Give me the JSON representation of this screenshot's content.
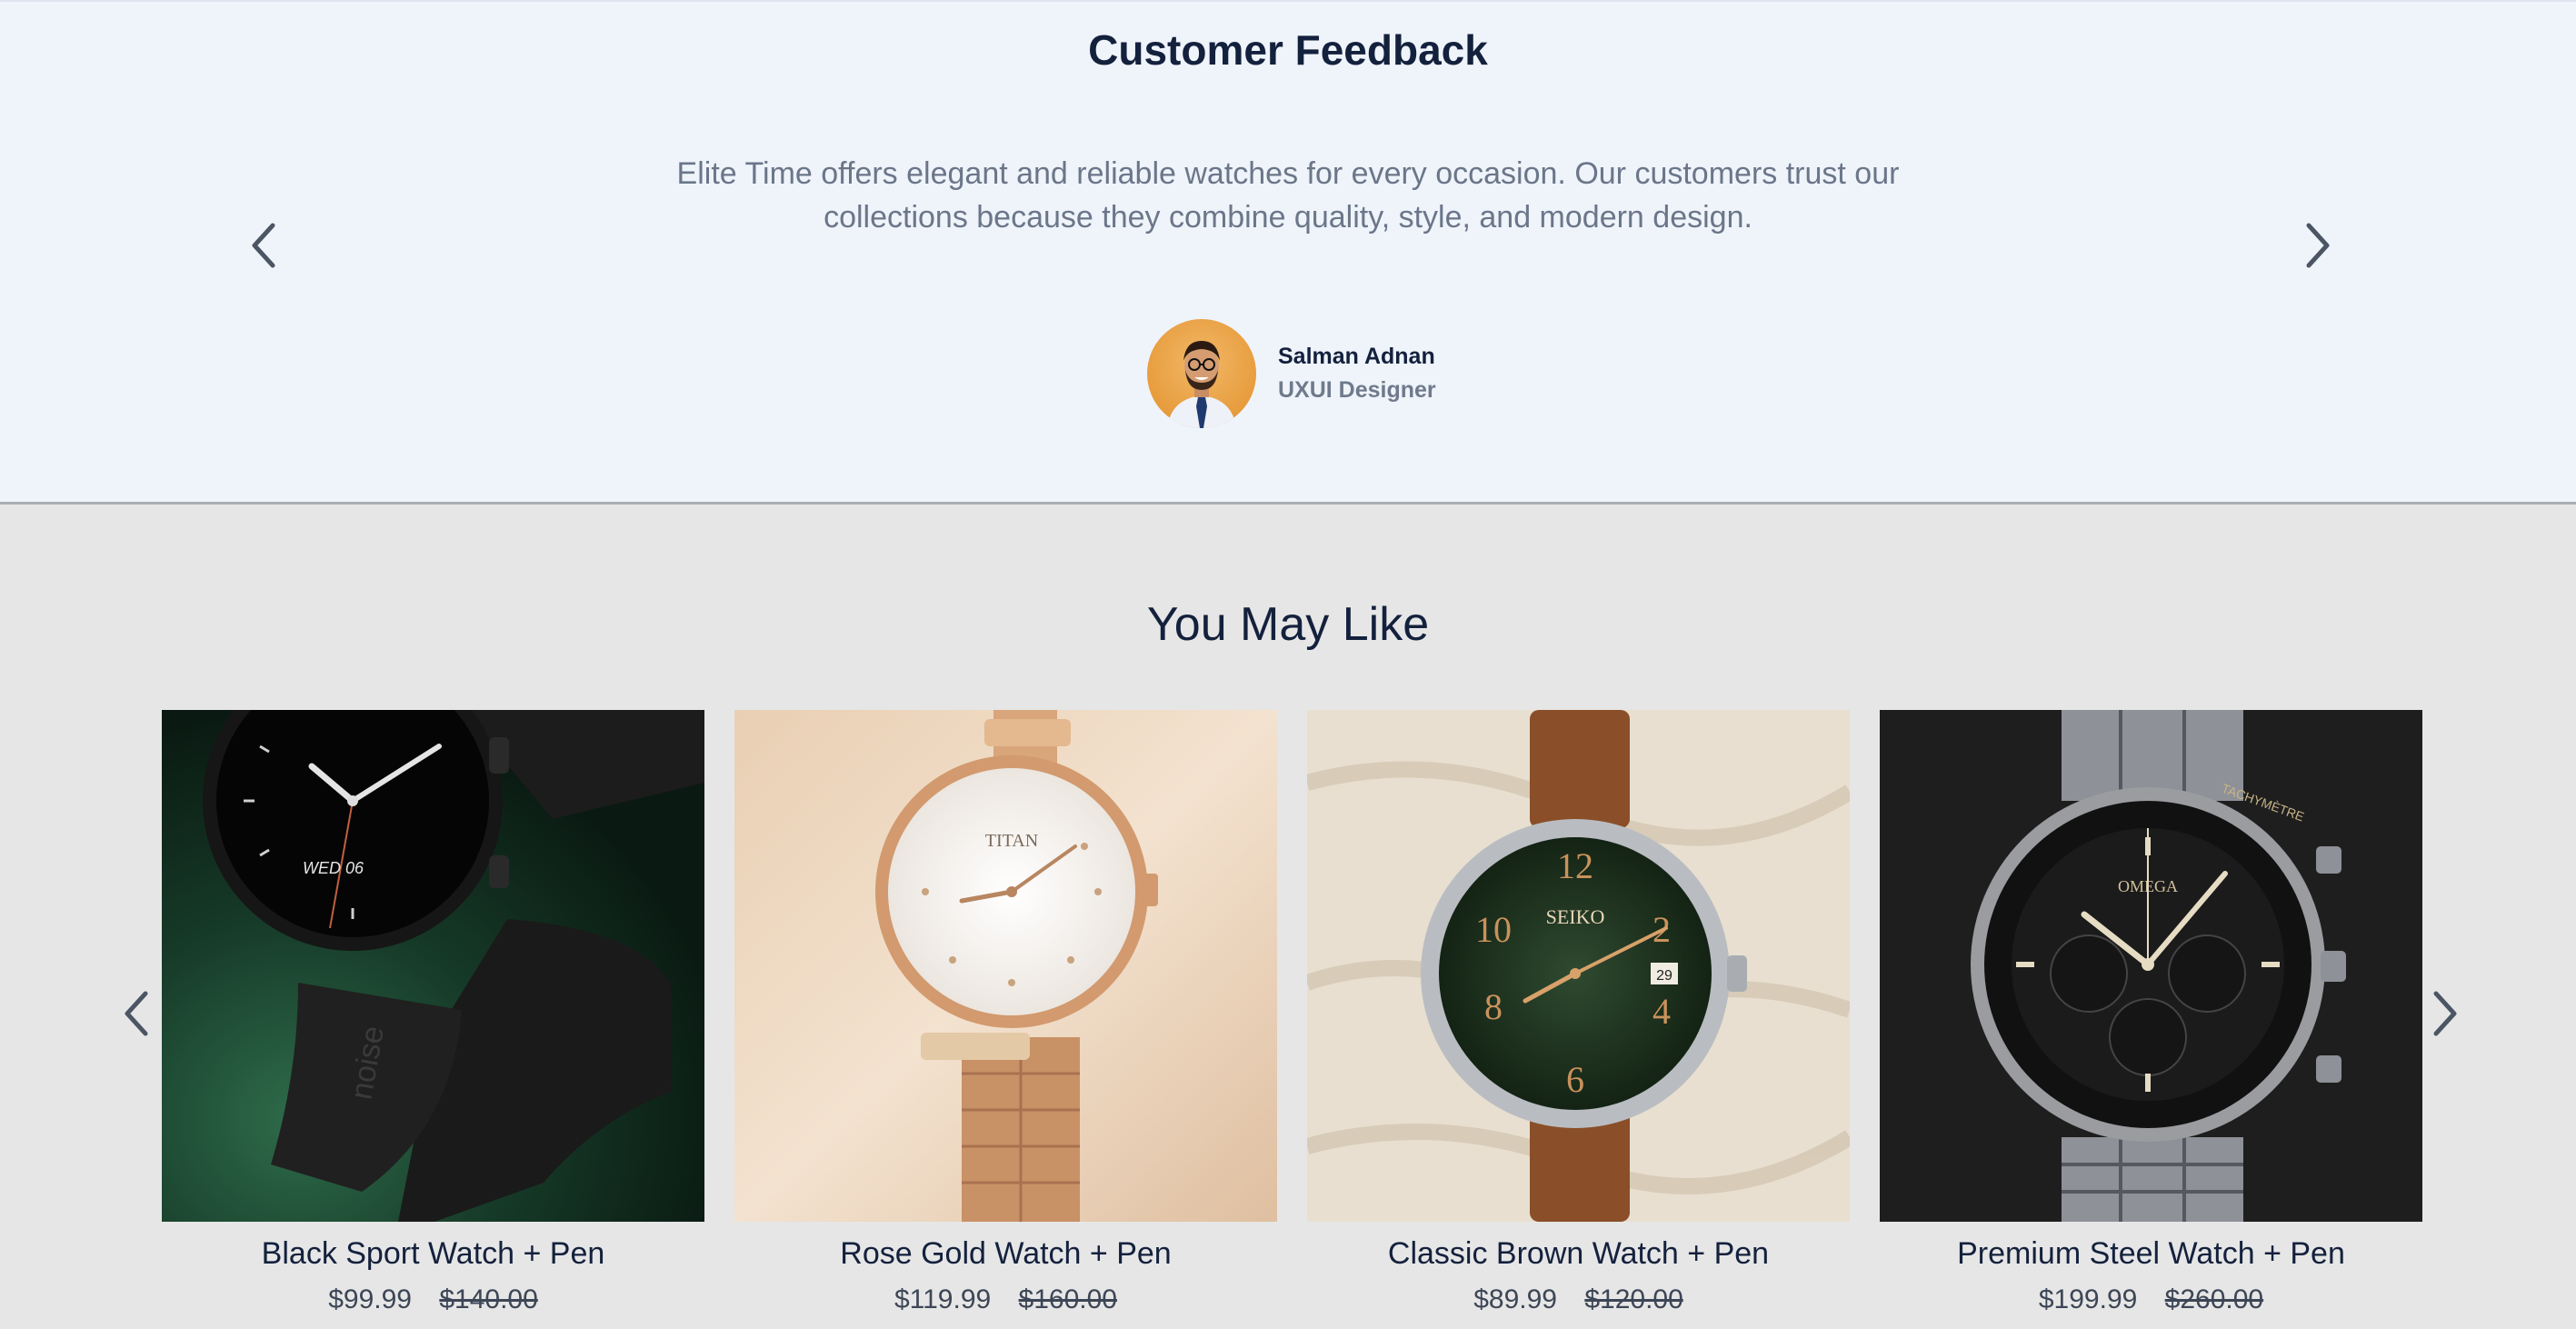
{
  "feedback": {
    "title": "Customer Feedback",
    "quote": "Elite Time offers elegant and reliable watches for every occasion. Our customers trust our collections because they combine quality, style, and modern design.",
    "author_name": "Salman Adnan",
    "author_role": "UXUI Designer",
    "prev_icon": "chevron-left-icon",
    "next_icon": "chevron-right-icon"
  },
  "recommendations": {
    "title": "You May Like",
    "products": [
      {
        "name": "Black Sport Watch + Pen",
        "price": "$99.99",
        "old_price": "$140.00",
        "brand_text": "noise",
        "dial_text": "WED 06"
      },
      {
        "name": "Rose Gold Watch + Pen",
        "price": "$119.99",
        "old_price": "$160.00",
        "brand_text": "TITAN"
      },
      {
        "name": "Classic Brown Watch + Pen",
        "price": "$89.99",
        "old_price": "$120.00",
        "brand_text": "SEIKO",
        "date_text": "29"
      },
      {
        "name": "Premium Steel Watch + Pen",
        "price": "$199.99",
        "old_price": "$260.00",
        "brand_text": "OMEGA",
        "bezel_text": "TACHYMÈTRE"
      }
    ]
  },
  "colors": {
    "heading": "#14213d",
    "muted": "#6b7689",
    "feedback_bg": "#eff4fb",
    "section_bg": "#e6e6e6"
  }
}
